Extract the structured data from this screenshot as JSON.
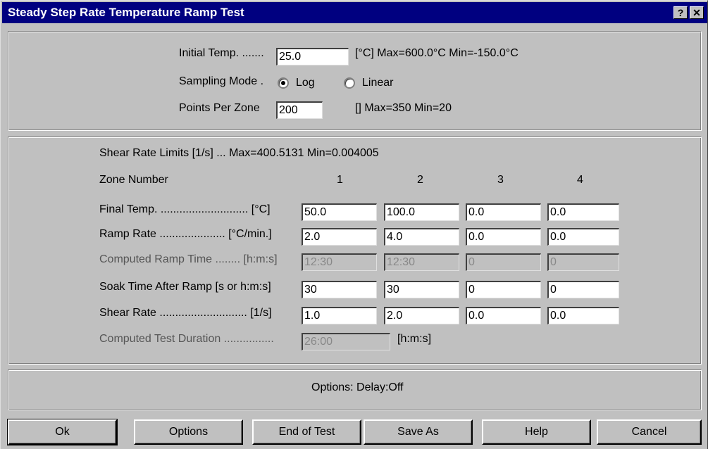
{
  "window": {
    "title": "Steady Step Rate Temperature Ramp Test",
    "help_glyph": "?",
    "close_glyph": "✕"
  },
  "setup": {
    "initial_temp_label": "Initial Temp. .......",
    "initial_temp_value": "25.0",
    "initial_temp_hint": "[°C] Max=600.0°C  Min=-150.0°C",
    "sampling_label": "Sampling Mode .",
    "sampling_log": "Log",
    "sampling_linear": "Linear",
    "sampling_selected": "Log",
    "points_label": "Points Per Zone",
    "points_value": "200",
    "points_hint": "[] Max=350 Min=20"
  },
  "zones": {
    "shear_limits": "Shear Rate Limits [1/s] ... Max=400.5131  Min=0.004005",
    "zone_number_label": "Zone Number",
    "zone_numbers": [
      "1",
      "2",
      "3",
      "4"
    ],
    "rows": [
      {
        "label": "Final Temp. ............................ [°C]",
        "values": [
          "50.0",
          "100.0",
          "0.0",
          "0.0"
        ],
        "disabled": false
      },
      {
        "label": "Ramp Rate ..................... [°C/min.]",
        "values": [
          "2.0",
          "4.0",
          "0.0",
          "0.0"
        ],
        "disabled": false
      },
      {
        "label": "Computed Ramp Time ........ [h:m:s]",
        "values": [
          "12:30",
          "12:30",
          "0",
          "0"
        ],
        "disabled": true
      },
      {
        "label": "Soak Time After Ramp  [s or h:m:s]",
        "values": [
          "30",
          "30",
          "0",
          "0"
        ],
        "disabled": false
      },
      {
        "label": "Shear Rate ............................ [1/s]",
        "values": [
          "1.0",
          "2.0",
          "0.0",
          "0.0"
        ],
        "disabled": false
      }
    ],
    "duration_label": "Computed Test Duration ................",
    "duration_value": "26:00",
    "duration_unit": "[h:m:s]"
  },
  "options": {
    "summary": "Options:  Delay:Off"
  },
  "buttons": {
    "ok": "Ok",
    "options": "Options",
    "end_of_test": "End of Test",
    "save_as": "Save As",
    "help": "Help",
    "cancel": "Cancel"
  }
}
